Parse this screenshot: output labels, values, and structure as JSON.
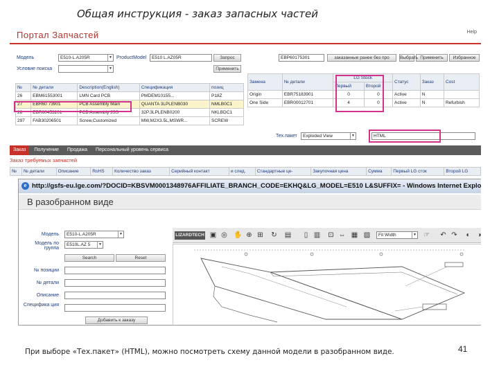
{
  "slide": {
    "title": "Общая инструкция - заказ запасных частей",
    "caption": "При выборе «Тех.пакет» (HTML), можно посмотреть схему данной модели в разобранном виде.",
    "page_number": "41"
  },
  "portal": {
    "title": "Портал Запчастей",
    "help": "Help"
  },
  "search": {
    "model_label": "Модель",
    "model_value": "E510-L.A205R",
    "product_model_label": "ProductModel",
    "product_model_value": "E510 L.AZ05R",
    "request_button": "Запрос",
    "condition_label": "Условие поиска",
    "apply_button": "Применить",
    "part_no_field_value": "EBP60175301",
    "order_prev_button": "заказанные ранее без про",
    "apply_button2": "Применить",
    "select_button": "Выбрать",
    "favorites_button": "Избранное"
  },
  "left_table": {
    "headers": [
      "№",
      "№ детали",
      "Description(English)",
      "Спецификация",
      "позиц"
    ],
    "rows": [
      [
        "26",
        "EBM61553001",
        "LMN Card PCB",
        "PMDEM10155...",
        "P18Z"
      ],
      [
        "27",
        "EBR60 73901",
        "PCB Assembly Main",
        "QUANTA 3LPLENB030",
        "NMLB0C1"
      ],
      [
        "28",
        "EBR60453201",
        "PCB Assembly JSS",
        "32P.3LPLENB0200",
        "NKLBDC1"
      ],
      [
        "297",
        "FAB30206501",
        "Screw,Customized",
        "MW,M2X3.5L,MSWR...",
        "SCREW"
      ]
    ]
  },
  "right_table": {
    "headers": [
      "Замена",
      "№ детали",
      "LG Stock",
      "Первый",
      "Второй",
      "Статус",
      "Заказ",
      "Cost"
    ],
    "stock_header": "LG Stock",
    "stock_first": "Первый",
    "stock_second": "Второй",
    "status_header": "Статус",
    "order_header": "Заказ",
    "cost_header": "Cost",
    "rows": [
      [
        "Origin",
        "EBR75183901",
        "0",
        "0",
        "Active",
        "N",
        ""
      ],
      [
        "One Side",
        "EBR00012701",
        "4",
        "0",
        "Active",
        "N",
        "Refurbish"
      ]
    ]
  },
  "tech_pack": {
    "label": "Тех.пакет",
    "value": "Exploded View",
    "format": "HTML"
  },
  "tabs": [
    {
      "label": "Заказ",
      "active": true
    },
    {
      "label": "Получение",
      "active": false
    },
    {
      "label": "Продажа",
      "active": false
    },
    {
      "label": "Персональный уровень сервиса",
      "active": false
    }
  ],
  "order_section": {
    "title": "Заказ требуемых запчастей",
    "headers": [
      "№",
      "№ детали",
      "Описание",
      "RoHS",
      "Количество заказ",
      "Серийный контакт",
      "и след.",
      "Стандартные це-",
      "Закупочная цена",
      "Сумма",
      "Первый LG сток",
      "Второй LG"
    ]
  },
  "browser": {
    "title": "http://gsfs-eu.lge.com/?DOCID=KBSVM0001348976AFFILIATE_BRANCH_CODE=EKHQ&LG_MODEL=E510 L&SUFFIX= - Windows Internet Explorer",
    "page_heading": "В разобранном виде",
    "model_label": "Модель",
    "model_value": "E510-L.A205R",
    "group_label": "Модель по группа",
    "group_value": "E510L.AZ 5",
    "search_button": "Search",
    "reset_button": "Reset",
    "pos_label": "№ позиции",
    "part_label": "№ детали",
    "desc_label": "Описание",
    "spec_label": "Специфика ция",
    "add_to_basket": "Добавить к заказу",
    "viewer_logo": "LIZARDTECH",
    "fit_option": "Fit Width"
  },
  "colors": {
    "accent": "#c8312a",
    "highlight": "#d2318c",
    "link": "#1d3b78"
  }
}
